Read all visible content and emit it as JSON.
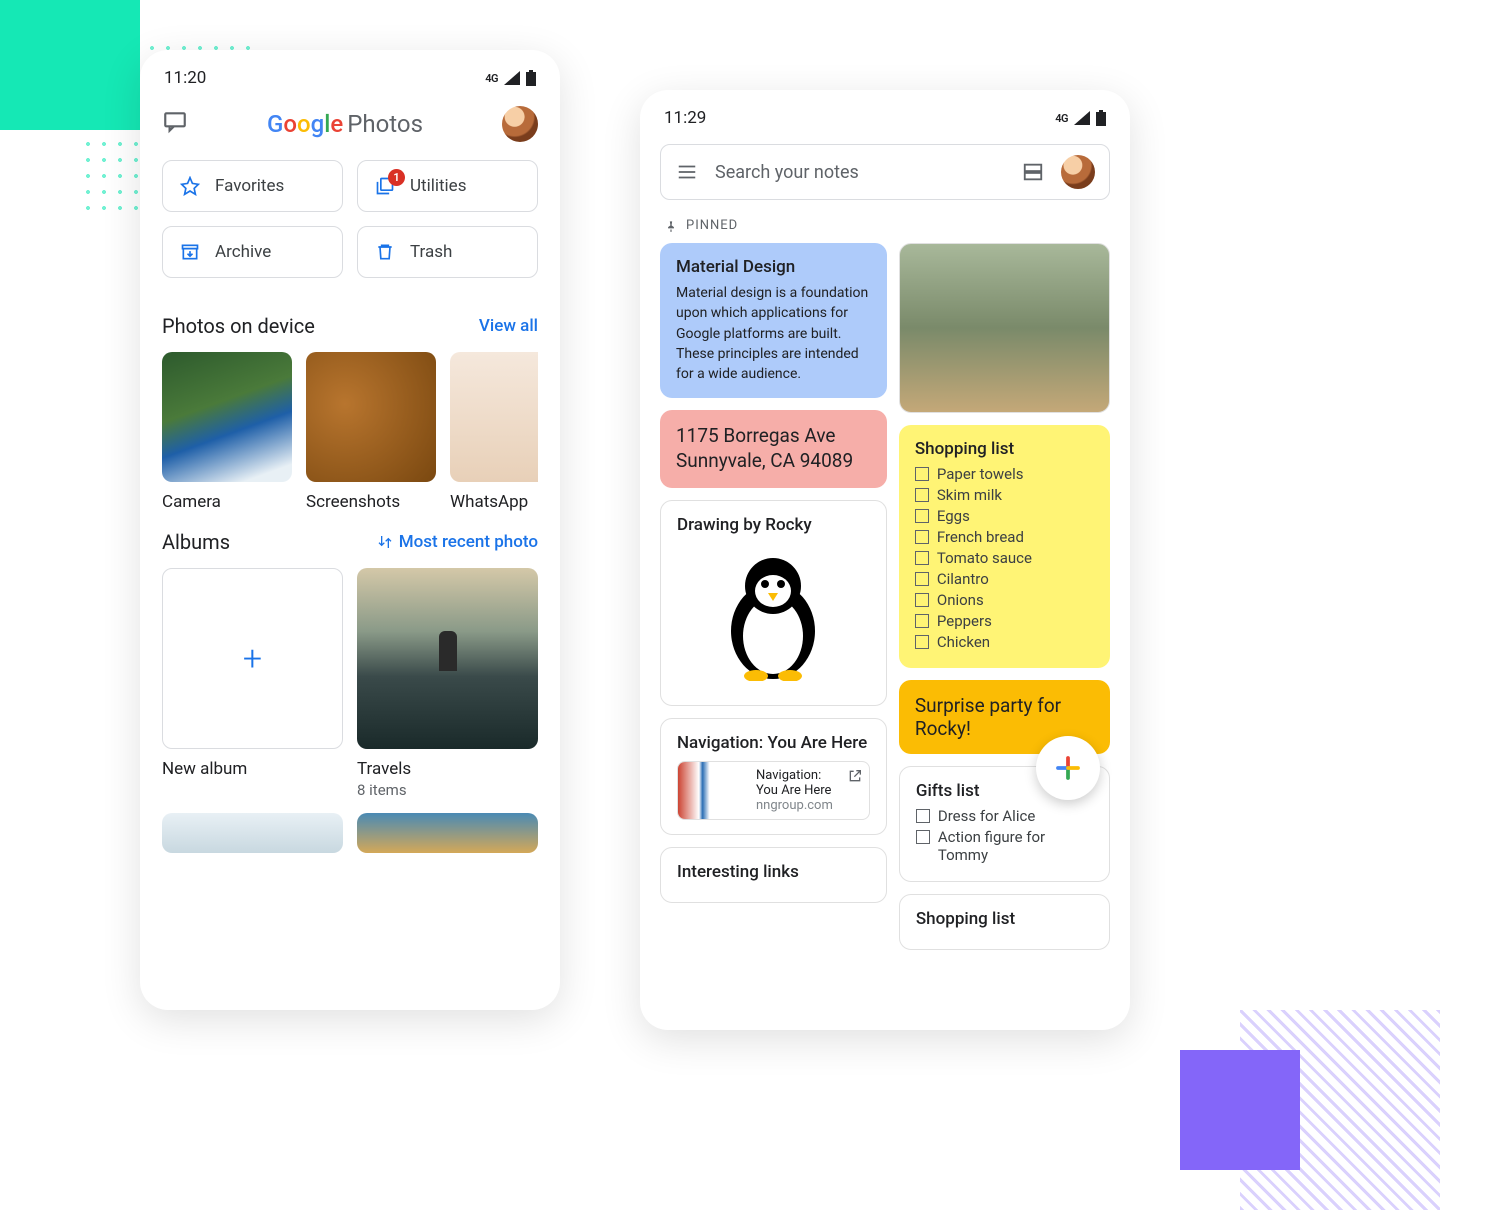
{
  "phoneA": {
    "status": {
      "time": "11:20",
      "network": "4G"
    },
    "header": {
      "google": "Google",
      "photos": "Photos"
    },
    "chips": {
      "favorites": "Favorites",
      "utilities": "Utilities",
      "utilities_badge": "1",
      "archive": "Archive",
      "trash": "Trash"
    },
    "device_section": {
      "title": "Photos on device",
      "link": "View all"
    },
    "device_folders": [
      {
        "label": "Camera"
      },
      {
        "label": "Screenshots"
      },
      {
        "label": "WhatsApp"
      }
    ],
    "albums_section": {
      "title": "Albums",
      "sort": "Most recent photo"
    },
    "albums": {
      "new": "New album",
      "travels": {
        "title": "Travels",
        "subtitle": "8 items"
      }
    }
  },
  "phoneB": {
    "status": {
      "time": "11:29",
      "network": "4G"
    },
    "search": {
      "placeholder": "Search your notes"
    },
    "pinned_label": "PINNED",
    "notes": {
      "material": {
        "title": "Material Design",
        "body": "Material design is a foundation upon which applications for Google platforms are built. These principles are intended for a wide audience."
      },
      "address": "1175 Borregas Ave Sunnyvale, CA 94089",
      "drawing": "Drawing by Rocky",
      "nav": {
        "title": "Navigation: You Are Here",
        "link_title": "Navigation: You Are Here",
        "link_source": "nngroup.com"
      },
      "links": "Interesting links",
      "shopping": {
        "title": "Shopping list",
        "items": [
          "Paper towels",
          "Skim milk",
          "Eggs",
          "French bread",
          "Tomato sauce",
          "Cilantro",
          "Onions",
          "Peppers",
          "Chicken"
        ]
      },
      "party": "Surprise party for Rocky!",
      "gifts": {
        "title": "Gifts list",
        "items": [
          "Dress for Alice",
          "Action figure for Tommy"
        ]
      },
      "shopping2": "Shopping list"
    }
  }
}
